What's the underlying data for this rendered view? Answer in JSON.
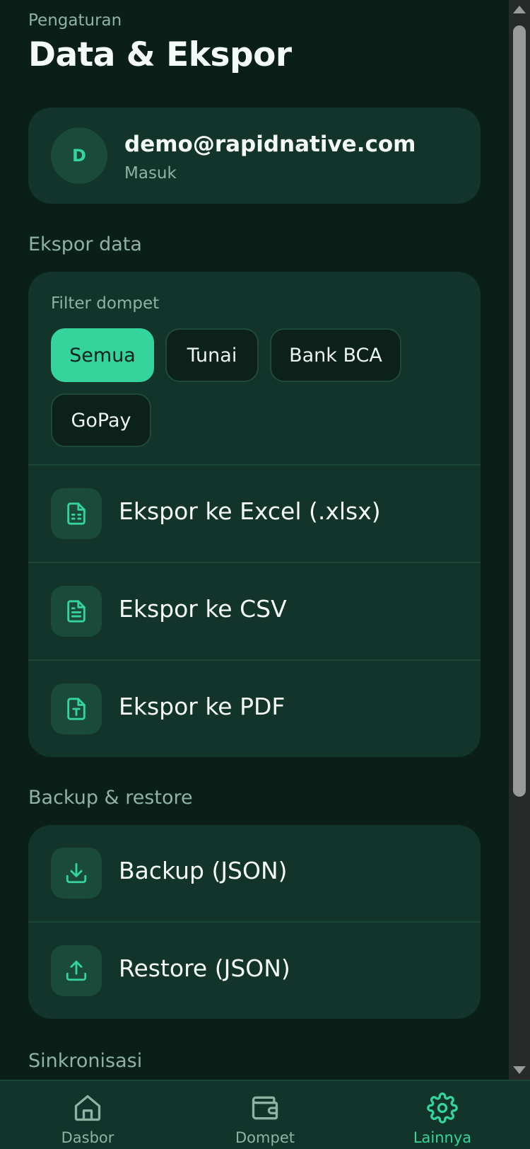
{
  "header": {
    "eyebrow": "Pengaturan",
    "title": "Data & Ekspor"
  },
  "account": {
    "avatar_initial": "D",
    "email": "demo@rapidnative.com",
    "status": "Masuk"
  },
  "export": {
    "section_label": "Ekspor data",
    "filter_label": "Filter dompet",
    "chips": [
      {
        "label": "Semua",
        "selected": true
      },
      {
        "label": "Tunai",
        "selected": false
      },
      {
        "label": "Bank BCA",
        "selected": false
      },
      {
        "label": "GoPay",
        "selected": false
      }
    ],
    "actions": [
      {
        "label": "Ekspor ke Excel (.xlsx)",
        "icon": "spreadsheet-file-icon"
      },
      {
        "label": "Ekspor ke CSV",
        "icon": "text-file-icon"
      },
      {
        "label": "Ekspor ke PDF",
        "icon": "pdf-file-icon"
      }
    ]
  },
  "backup": {
    "section_label": "Backup & restore",
    "actions": [
      {
        "label": "Backup (JSON)",
        "icon": "download-icon"
      },
      {
        "label": "Restore (JSON)",
        "icon": "upload-icon"
      }
    ]
  },
  "sync": {
    "section_label": "Sinkronisasi"
  },
  "tabbar": {
    "tabs": [
      {
        "label": "Dasbor",
        "icon": "home-icon",
        "active": false
      },
      {
        "label": "Dompet",
        "icon": "wallet-icon",
        "active": false
      },
      {
        "label": "Lainnya",
        "icon": "gear-icon",
        "active": true
      }
    ]
  },
  "colors": {
    "background": "#0a1f18",
    "card": "#13342a",
    "accent": "#35d49c",
    "muted_text": "#8fb3a3"
  }
}
